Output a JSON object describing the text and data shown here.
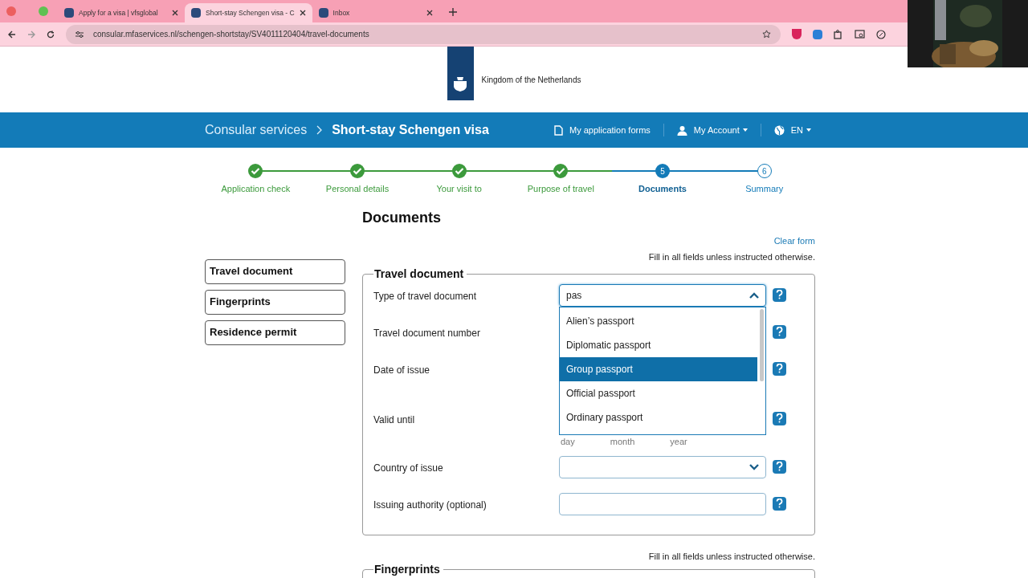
{
  "browser": {
    "tabs": [
      {
        "title": "Apply for a visa | vfsglobal",
        "selected": false
      },
      {
        "title": "Short-stay Schengen visa - C",
        "selected": true
      },
      {
        "title": "Inbox",
        "selected": false
      }
    ],
    "url": "consular.mfaservices.nl/schengen-shortstay/SV4011120404/travel-documents"
  },
  "header": {
    "logo_text": "Kingdom of the Netherlands"
  },
  "navbar": {
    "parent": "Consular services",
    "current": "Short-stay Schengen visa",
    "links": [
      {
        "label": "My application forms",
        "kind": "forms"
      },
      {
        "label": "My Account",
        "kind": "account"
      },
      {
        "label": "EN",
        "kind": "language"
      }
    ]
  },
  "steps": [
    {
      "label": "Application check",
      "completed": true,
      "selected": false
    },
    {
      "label": "Personal details",
      "completed": true,
      "selected": false
    },
    {
      "label": "Your visit to",
      "completed": true,
      "selected": false
    },
    {
      "label": "Purpose of travel",
      "completed": true,
      "selected": false
    },
    {
      "label": "Documents",
      "number": "5",
      "completed": false,
      "selected": true
    },
    {
      "label": "Summary",
      "number": "6",
      "completed": false,
      "selected": false
    }
  ],
  "page_title": "Documents",
  "clear_form": "Clear form",
  "side_nav": [
    {
      "label": "Travel document"
    },
    {
      "label": "Fingerprints"
    },
    {
      "label": "Residence permit"
    }
  ],
  "travel_document": {
    "title": "Travel document",
    "instruction": "Fill in all fields unless instructed otherwise.",
    "fields": [
      {
        "label": "Type of travel document",
        "kind": "combo",
        "value": "pas"
      },
      {
        "label": "Travel document number",
        "kind": "covered"
      },
      {
        "label": "Date of issue",
        "kind": "covered_date"
      },
      {
        "label": "Valid until",
        "kind": "date",
        "parts": [
          "day",
          "month",
          "year"
        ]
      },
      {
        "label": "Country of issue",
        "kind": "select"
      },
      {
        "label": "Issuing authority (optional)",
        "kind": "text"
      }
    ],
    "options": [
      {
        "label": "Alien’s passport",
        "selected": false
      },
      {
        "label": "Diplomatic passport",
        "selected": false
      },
      {
        "label": "Group passport",
        "selected": true
      },
      {
        "label": "Official passport",
        "selected": false
      },
      {
        "label": "Ordinary passport",
        "selected": false
      }
    ]
  },
  "fingerprints": {
    "title": "Fingerprints",
    "instruction": "Fill in all fields unless instructed otherwise."
  }
}
